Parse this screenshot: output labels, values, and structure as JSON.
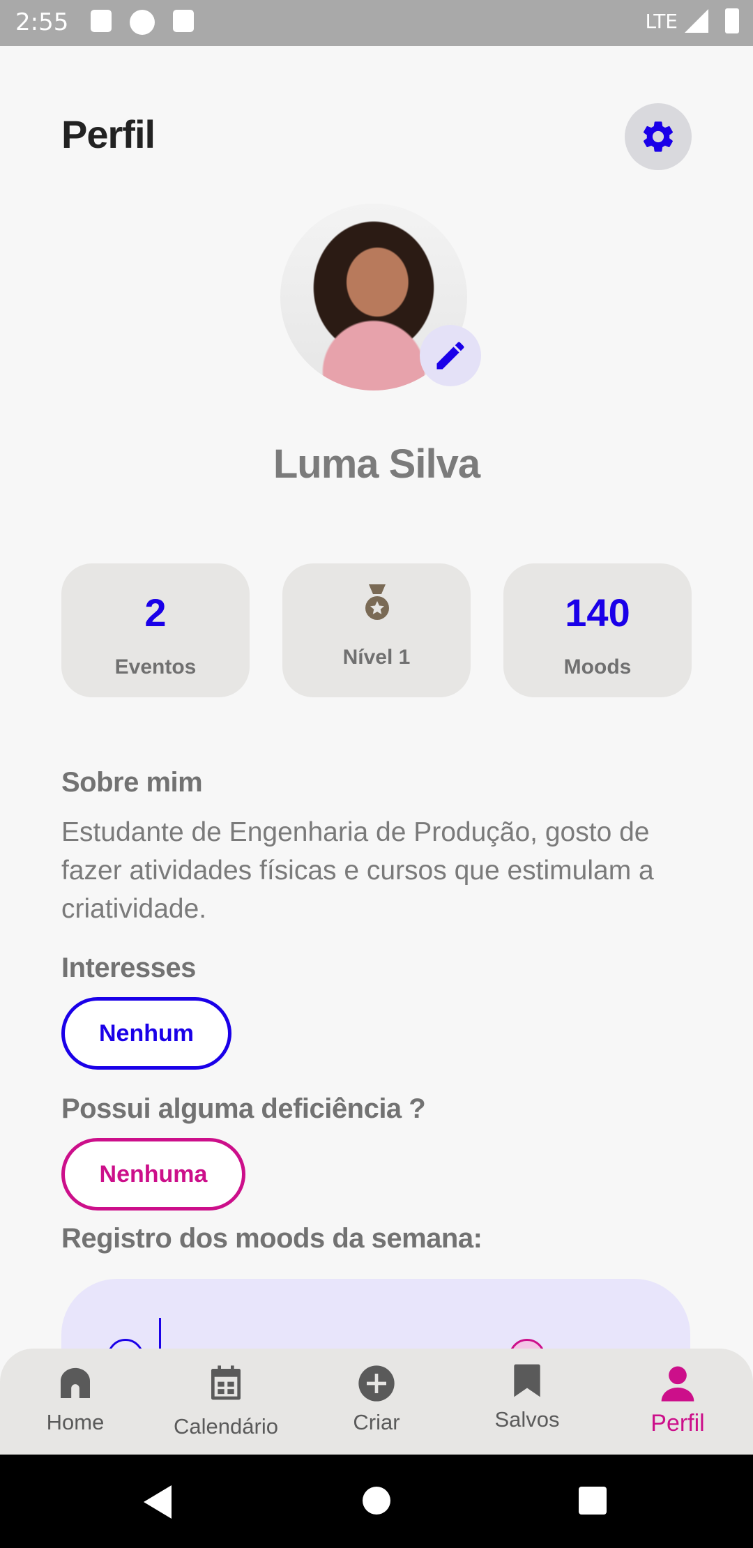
{
  "status_bar": {
    "time": "2:55",
    "network": "LTE"
  },
  "header": {
    "title": "Perfil"
  },
  "profile": {
    "name": "Luma Silva"
  },
  "stats": {
    "events": {
      "value": "2",
      "label": "Eventos"
    },
    "level": {
      "label": "Nível 1"
    },
    "moods": {
      "value": "140",
      "label": "Moods"
    }
  },
  "about": {
    "heading": "Sobre mim",
    "text": "Estudante de Engenharia de Produção, gosto de fazer atividades físicas e cursos que estimulam a criatividade."
  },
  "interests": {
    "heading": "Interesses",
    "value": "Nenhum"
  },
  "disability": {
    "heading": "Possui alguma deficiência ?",
    "value": "Nenhuma"
  },
  "moods_section": {
    "heading": "Registro dos moods da semana:"
  },
  "bottom_nav": {
    "items": [
      {
        "label": "Home",
        "icon": "home-icon"
      },
      {
        "label": "Calendário",
        "icon": "calendar-icon"
      },
      {
        "label": "Criar",
        "icon": "add-circle-icon"
      },
      {
        "label": "Salvos",
        "icon": "bookmark-icon"
      },
      {
        "label": "Perfil",
        "icon": "person-icon"
      }
    ]
  },
  "colors": {
    "accent_blue": "#1a00e8",
    "accent_pink": "#cc0f8a",
    "card_bg": "#e7e6e4",
    "mood_card_bg": "#e8e5fb"
  }
}
